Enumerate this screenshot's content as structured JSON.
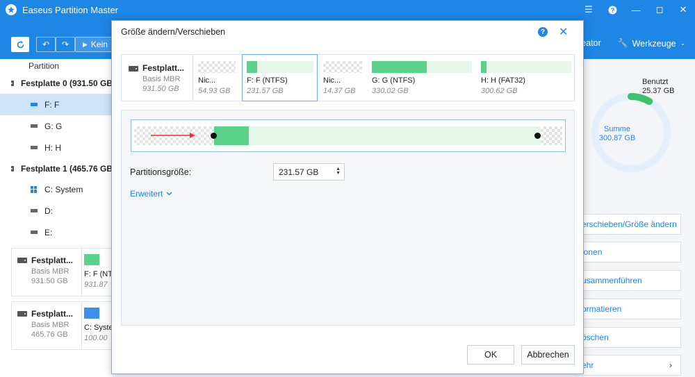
{
  "app": {
    "title": "Easeus Partition Master",
    "window_controls": [
      "menu-icon",
      "help-icon",
      "minimize-icon",
      "maximize-icon",
      "close-icon"
    ]
  },
  "toolbar": {
    "execute_label": "Kein",
    "creator_label": "reator",
    "tools_label": "Werkzeuge"
  },
  "left_panel": {
    "column_header": "Partition",
    "rows": [
      {
        "label": "Festplatte 0 (931.50 GB",
        "type": "disk"
      },
      {
        "label": "F: F",
        "type": "part",
        "selected": true
      },
      {
        "label": "G: G",
        "type": "part"
      },
      {
        "label": "H: H",
        "type": "part"
      },
      {
        "label": "Festplatte 1 (465.76 GB",
        "type": "disk"
      },
      {
        "label": "C: System",
        "type": "system"
      },
      {
        "label": "D:",
        "type": "part"
      },
      {
        "label": "E:",
        "type": "part"
      }
    ]
  },
  "bottom_cards": [
    {
      "title": "Festplatt...",
      "sub1": "Basis MBR",
      "sub2": "931.50 GB",
      "part_label": "F: F (NTF",
      "part_size": "931.87",
      "bar_color": "#5bd28a"
    },
    {
      "title": "Festplatt...",
      "sub1": "Basis MBR",
      "sub2": "465.76 GB",
      "part_label": "C: Syste",
      "part_size": "100.00",
      "bar_color": "#3d8ff0"
    }
  ],
  "right_panel": {
    "used_label": "Benutzt",
    "used_value": "25.37 GB",
    "total_label": "Summe",
    "total_value": "300.87 GB",
    "used_fraction": 0.084,
    "actions": [
      "erschieben/Größe ändern",
      "ionen",
      "usammenführen",
      "ormatieren",
      "öschen",
      "ehr"
    ]
  },
  "dialog": {
    "title": "Größe ändern/Verschieben",
    "disk": {
      "title": "Festplatt...",
      "type": "Basis MBR",
      "size": "931.50 GB"
    },
    "partitions": [
      {
        "label": "Nic...",
        "size": "54.93 GB",
        "kind": "unalloc"
      },
      {
        "label": "F: F (NTFS)",
        "size": "231.57 GB",
        "kind": "part",
        "used_fraction": 0.16,
        "selected": true
      },
      {
        "label": "Nic...",
        "size": "14.37 GB",
        "kind": "unalloc"
      },
      {
        "label": "G: G (NTFS)",
        "size": "330.02 GB",
        "kind": "part",
        "used_fraction": 0.55
      },
      {
        "label": "H: H (FAT32)",
        "size": "300.62 GB",
        "kind": "part",
        "used_fraction": 0.06
      }
    ],
    "partition_size_label": "Partitionsgröße:",
    "partition_size_value": "231.57 GB",
    "advanced_label": "Erweitert",
    "ok_label": "OK",
    "cancel_label": "Abbrechen"
  },
  "colors": {
    "accent": "#1e86e5",
    "used": "#5bd28a",
    "free": "#e6f6eb"
  }
}
